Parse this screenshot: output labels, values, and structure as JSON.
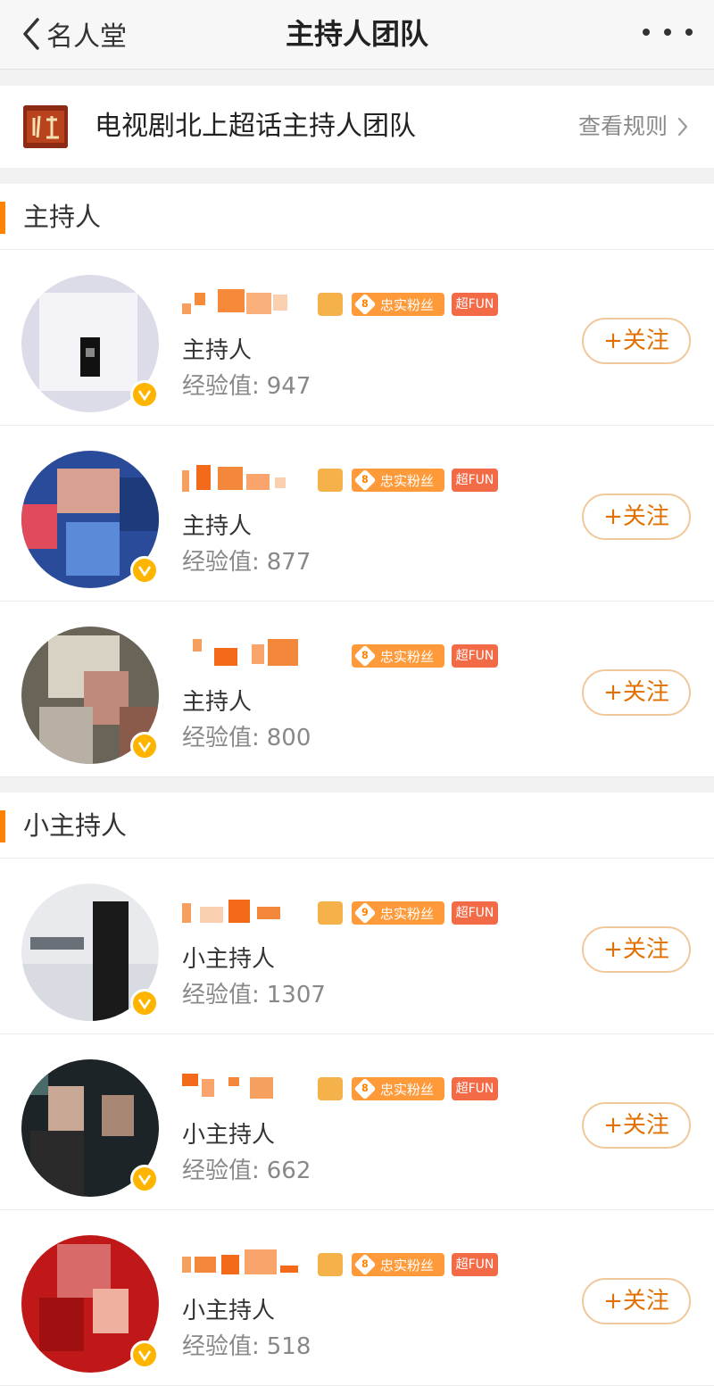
{
  "nav": {
    "back_label": "名人堂",
    "title": "主持人团队"
  },
  "topic": {
    "name": "电视剧北上超话主持人团队",
    "rule_link": "查看规则"
  },
  "badges": {
    "fan_label": "忠实粉丝",
    "fun_label": "超FUN"
  },
  "sections": [
    {
      "title": "主持人",
      "members": [
        {
          "role": "主持人",
          "exp_label": "经验值:",
          "exp_value": "947",
          "fan_level": "8",
          "follow_label": "+关注"
        },
        {
          "role": "主持人",
          "exp_label": "经验值:",
          "exp_value": "877",
          "fan_level": "8",
          "follow_label": "+关注"
        },
        {
          "role": "主持人",
          "exp_label": "经验值:",
          "exp_value": "800",
          "fan_level": "8",
          "follow_label": "+关注"
        }
      ]
    },
    {
      "title": "小主持人",
      "members": [
        {
          "role": "小主持人",
          "exp_label": "经验值:",
          "exp_value": "1307",
          "fan_level": "9",
          "follow_label": "+关注"
        },
        {
          "role": "小主持人",
          "exp_label": "经验值:",
          "exp_value": "662",
          "fan_level": "8",
          "follow_label": "+关注"
        },
        {
          "role": "小主持人",
          "exp_label": "经验值:",
          "exp_value": "518",
          "fan_level": "8",
          "follow_label": "+关注"
        }
      ]
    }
  ],
  "colors": {
    "accent": "#ff8200",
    "verified_badge": "#ffb400",
    "fan_badge": "#ff9a3a",
    "fun_badge": "#f26a46"
  }
}
